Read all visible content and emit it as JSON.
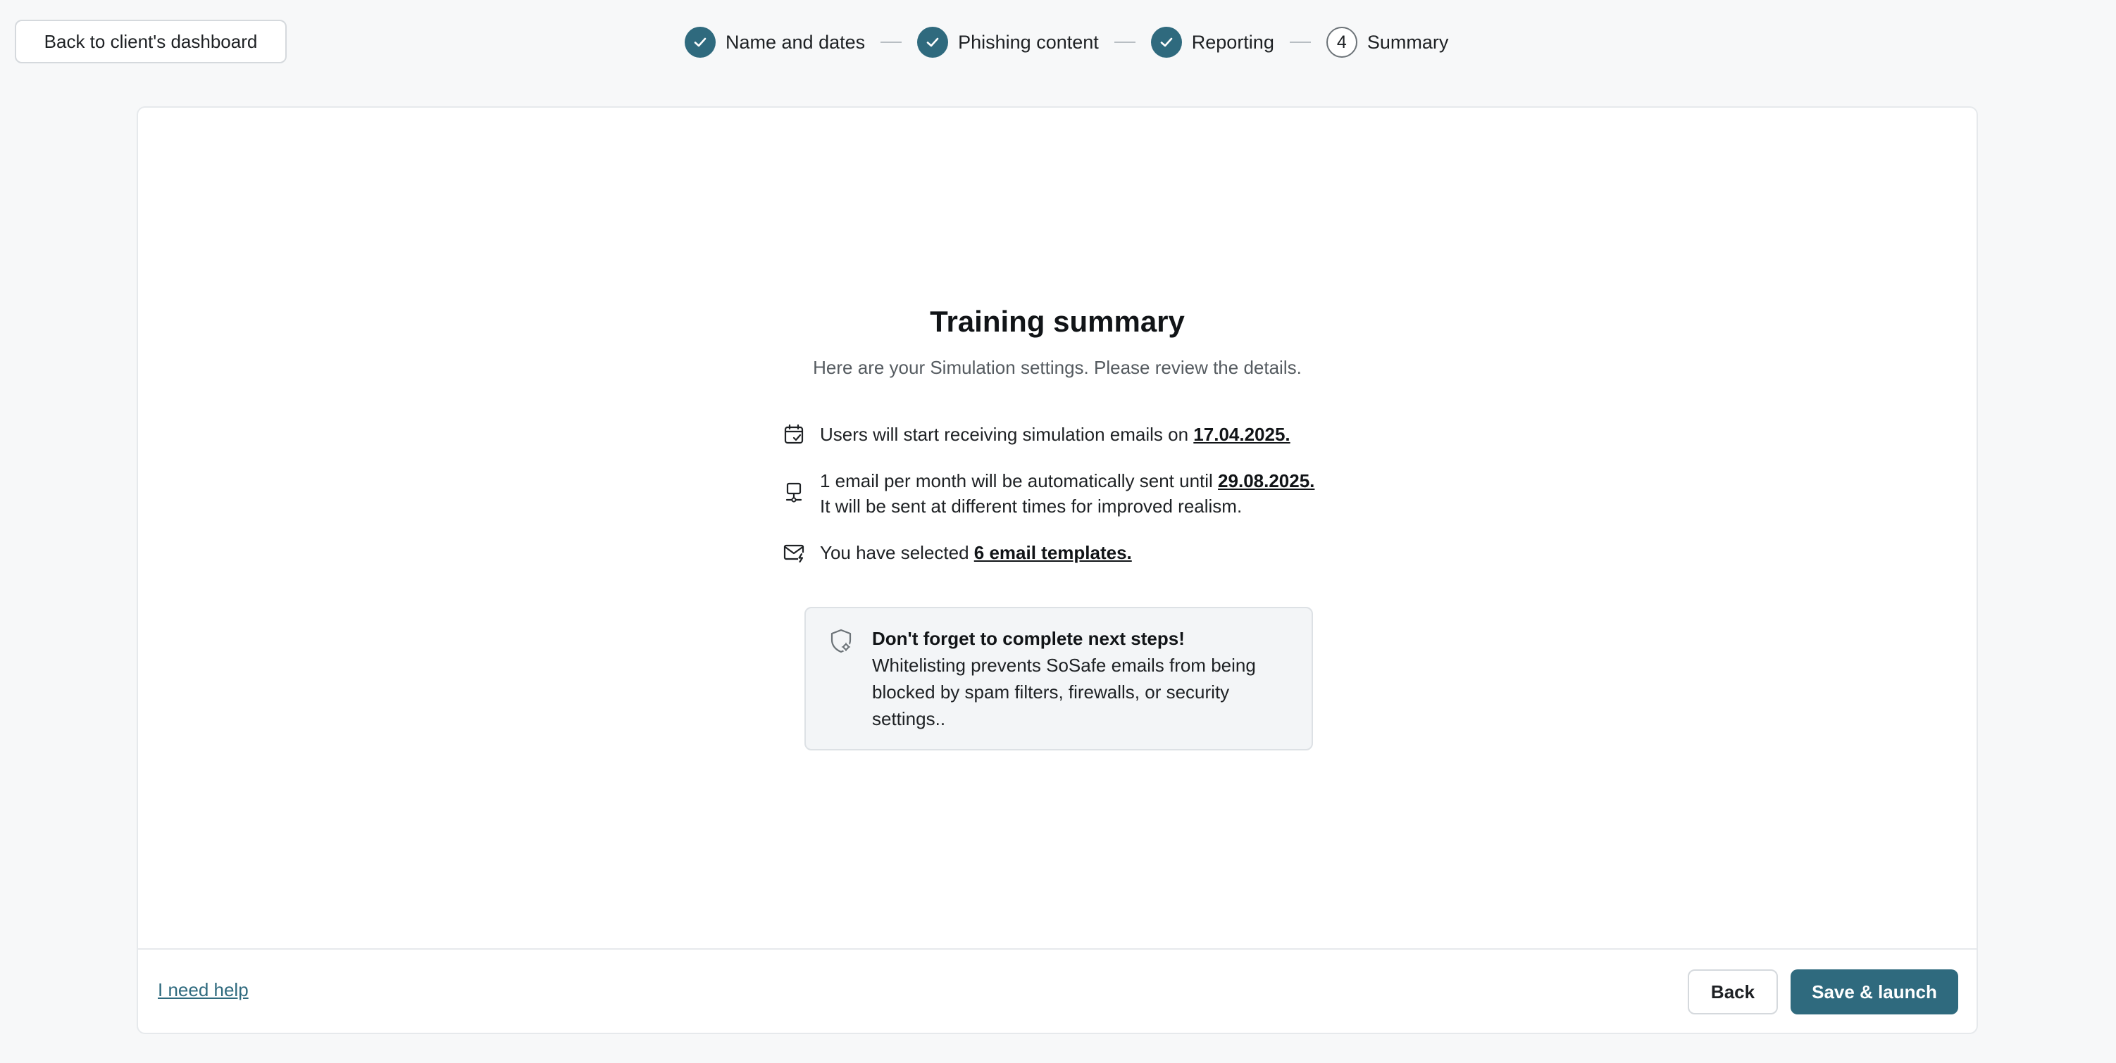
{
  "header": {
    "back_to_dashboard_label": "Back to client's dashboard",
    "steps": [
      {
        "label": "Name and dates",
        "state": "completed"
      },
      {
        "label": "Phishing content",
        "state": "completed"
      },
      {
        "label": "Reporting",
        "state": "completed"
      },
      {
        "label": "Summary",
        "state": "current",
        "number": "4"
      }
    ]
  },
  "summary": {
    "title": "Training summary",
    "subtitle": "Here are your Simulation settings. Please review the details.",
    "start": {
      "icon": "calendar-check-icon",
      "text": "Users will start receiving simulation emails on ",
      "date": "17.04.2025."
    },
    "frequency": {
      "icon": "monitor-schedule-icon",
      "text": "1 email per month will be automatically sent until ",
      "date": "29.08.2025.",
      "line2": "It will be sent at different times for improved realism."
    },
    "templates": {
      "icon": "mail-bolt-icon",
      "text": "You have selected ",
      "count_text": "6 email templates."
    },
    "notice": {
      "icon": "shield-gear-icon",
      "title": "Don't forget to complete next steps!",
      "body": "Whitelisting prevents SoSafe emails from being blocked by spam filters, firewalls, or security settings.."
    }
  },
  "footer": {
    "help_label": "I need help",
    "back_label": "Back",
    "launch_label": "Save & launch"
  },
  "colors": {
    "accent": "#2f6a7e",
    "page_background": "#f7f8f9",
    "card_background": "#ffffff"
  }
}
